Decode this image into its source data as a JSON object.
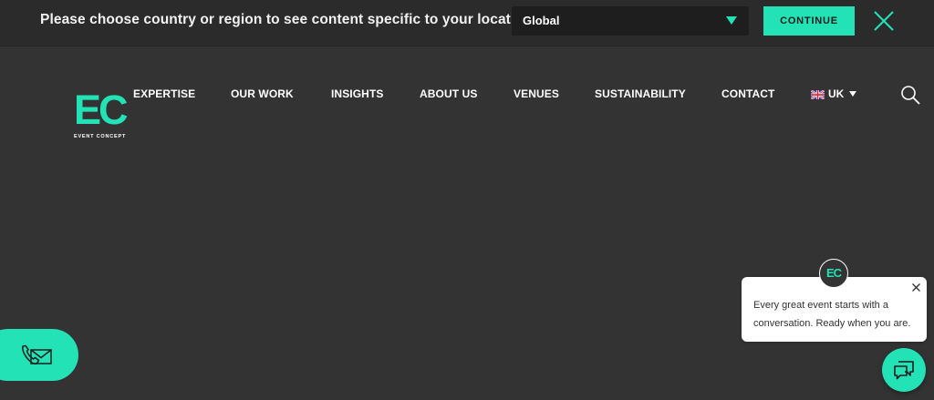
{
  "region_bar": {
    "prompt": "Please choose country or region to see content specific to your location",
    "selected_region": "Global",
    "continue_label": "CONTINUE",
    "close_icon": "close-icon"
  },
  "logo": {
    "mark": "EC",
    "subtitle": "EVENT CONCEPT"
  },
  "nav": {
    "items": [
      {
        "label": "EXPERTISE"
      },
      {
        "label": "OUR WORK"
      },
      {
        "label": "INSIGHTS"
      },
      {
        "label": "ABOUT US"
      },
      {
        "label": "VENUES"
      },
      {
        "label": "SUSTAINABILITY"
      },
      {
        "label": "CONTACT"
      }
    ],
    "language": "UK",
    "language_icon": "uk-flag-icon",
    "search_icon": "search-icon"
  },
  "contact": {
    "icon": "phone-mail-icon"
  },
  "chat": {
    "avatar_text": "EC",
    "message": "Every great event starts with a conversation. Ready when you are.",
    "close_icon": "close-icon",
    "launcher_icon": "chat-bubbles-icon"
  },
  "colors": {
    "accent": "#23e2b5",
    "background": "#333333",
    "bar_background": "#2b2b2b",
    "select_background": "#1e1e1e"
  }
}
